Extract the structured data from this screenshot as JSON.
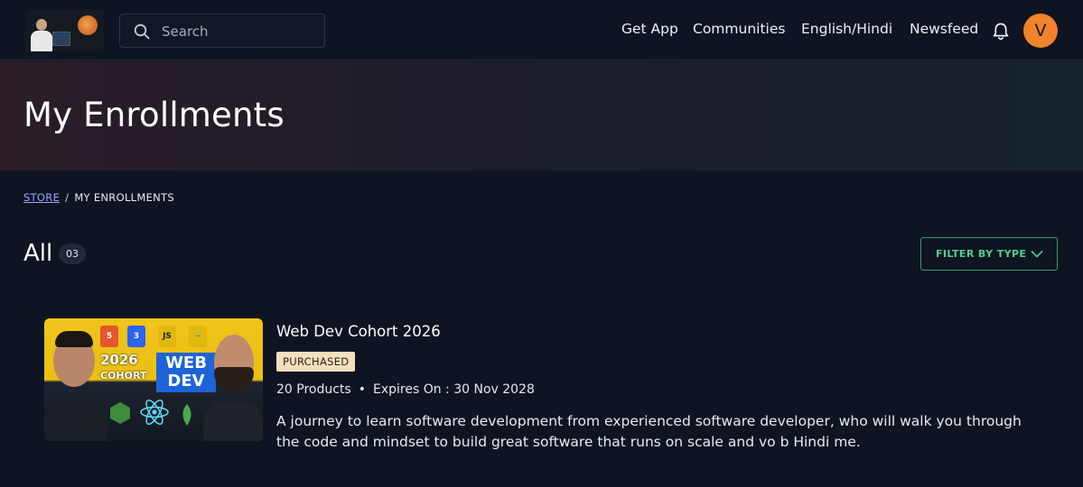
{
  "header": {
    "search": {
      "placeholder": "Search",
      "value": ""
    },
    "nav": [
      "Get App",
      "Communities",
      "English/Hindi",
      "Newsfeed"
    ],
    "avatar_initial": "V",
    "accent_color": "#f0832b"
  },
  "hero": {
    "title": "My Enrollments"
  },
  "breadcrumb": {
    "store": "STORE",
    "separator": "/",
    "current": "MY ENROLLMENTS"
  },
  "listing": {
    "heading": "All",
    "count": "03",
    "filter_label": "FILTER BY TYPE",
    "filter_color": "#2f9e67"
  },
  "courses": [
    {
      "title": "Web Dev Cohort 2026",
      "status": "PURCHASED",
      "products": "20 Products",
      "bullet": "•",
      "expires": "Expires On : 30 Nov 2028",
      "description": "A journey to learn software development from experienced software developer, who will walk you through the code and mindset to build great software that runs on scale and vo b Hindi me.",
      "thumbnail": {
        "year": "2026",
        "cohort": "COHORT",
        "web": "WEB",
        "dev": "DEV",
        "badges": [
          "5",
          "3",
          "JS"
        ]
      }
    }
  ]
}
